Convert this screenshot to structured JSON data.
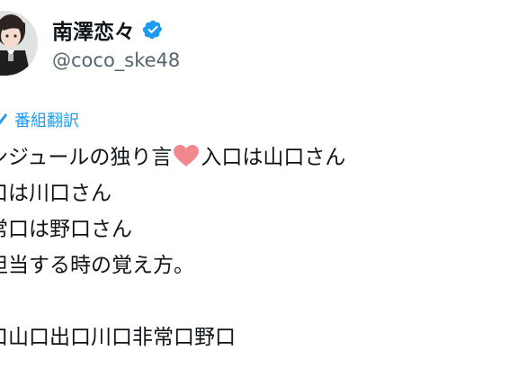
{
  "profile": {
    "display_name": "南澤恋々",
    "handle": "@coco_ske48",
    "verified_icon": "verified-badge-icon",
    "accent_color": "#1d9bf0"
  },
  "translation": {
    "label": "番組翻訳",
    "icon": "translate-icon"
  },
  "tweet": {
    "line1_before": "ンジュールの独り言",
    "line1_heart_icon": "heart-icon",
    "line1_after": "入口は山口さん",
    "line2": "口は川口さん",
    "line3": "常口は野口さん",
    "line4": "担当する時の覚え方。",
    "line6": "口山口出口川口非常口野口"
  }
}
